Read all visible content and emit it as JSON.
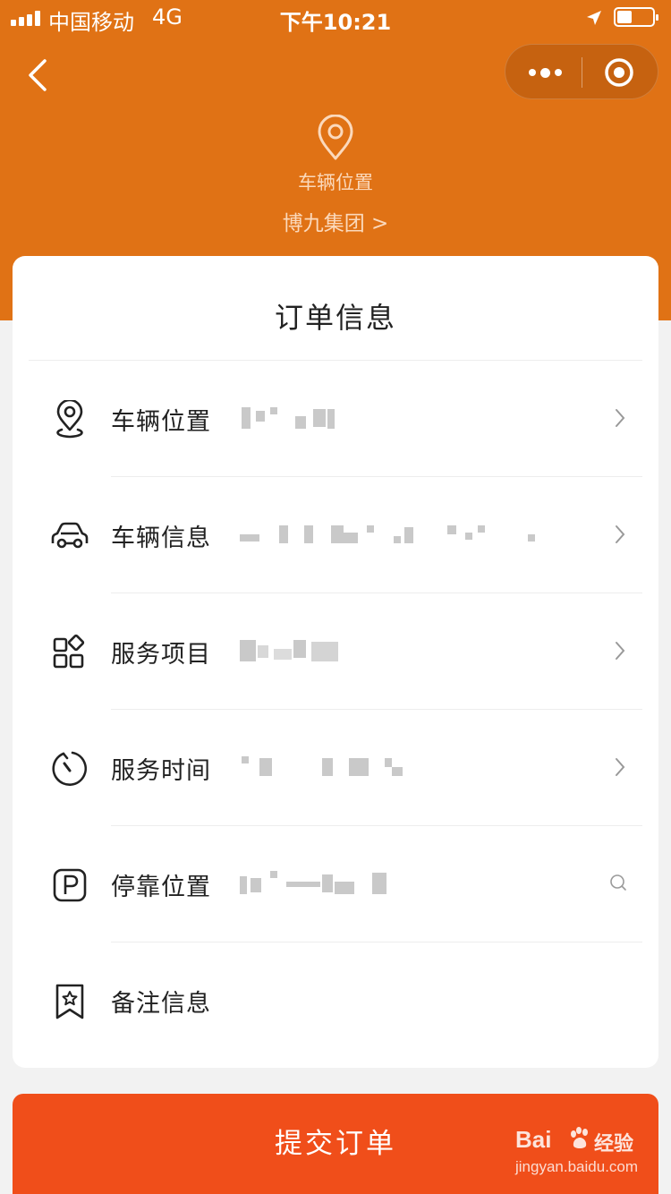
{
  "status_bar": {
    "carrier": "中国移动",
    "network": "4G",
    "time": "下午10:21"
  },
  "nav": {
    "back_icon": "chevron-left-icon",
    "more_icon": "more-dots-icon",
    "close_icon": "target-circle-icon"
  },
  "header": {
    "location_label": "车辆位置",
    "company_link": "博九集团 >"
  },
  "card": {
    "title": "订单信息",
    "rows": [
      {
        "label": "车辆位置",
        "icon": "location-pin-icon",
        "action_icon": "chevron-right-icon"
      },
      {
        "label": "车辆信息",
        "icon": "car-icon",
        "action_icon": "chevron-right-icon"
      },
      {
        "label": "服务项目",
        "icon": "grid-apps-icon",
        "action_icon": "chevron-right-icon"
      },
      {
        "label": "服务时间",
        "icon": "stopwatch-icon",
        "action_icon": "chevron-right-icon"
      },
      {
        "label": "停靠位置",
        "icon": "parking-icon",
        "action_icon": "search-icon"
      },
      {
        "label": "备注信息",
        "icon": "bookmark-star-icon",
        "action_icon": ""
      }
    ]
  },
  "submit_button": {
    "label": "提交订单"
  },
  "watermark": {
    "brand": "Bai",
    "brand_cn": "经验",
    "url": "jingyan.baidu.com"
  },
  "colors": {
    "header_bg": "#e07215",
    "submit_bg": "#f04e1a",
    "page_bg": "#f2f2f2"
  }
}
